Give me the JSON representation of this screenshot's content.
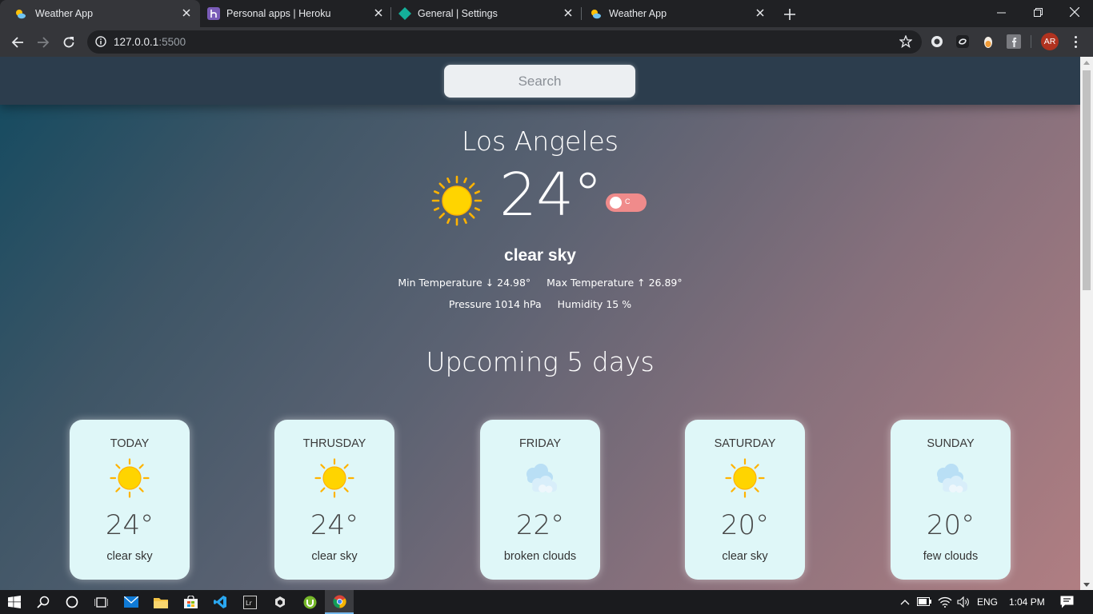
{
  "browser": {
    "tabs": [
      {
        "title": "Weather App",
        "icon": "weather-favicon",
        "active": true
      },
      {
        "title": "Personal apps | Heroku",
        "icon": "heroku-favicon",
        "active": false
      },
      {
        "title": "General | Settings",
        "icon": "settings-favicon",
        "active": false
      },
      {
        "title": "Weather App",
        "icon": "weather-favicon",
        "active": false
      }
    ],
    "url_host": "127.0.0.1",
    "url_port": ":5500",
    "profile_initials": "AR"
  },
  "page": {
    "search": {
      "placeholder": "Search",
      "value": ""
    },
    "city": "Los Angeles",
    "current": {
      "temperature": "24°",
      "unit_toggle": "C",
      "unit_is_celsius": true,
      "description": "clear sky",
      "icon": "sun-icon",
      "min_temp_label": "Min Temperature",
      "min_temp": "↓ 24.98°",
      "max_temp_label": "Max Temperature",
      "max_temp": "↑ 26.89°",
      "pressure_label": "Pressure",
      "pressure": "1014 hPa",
      "humidity_label": "Humidity",
      "humidity": "15 %"
    },
    "upcoming_title": "Upcoming 5 days",
    "forecast": [
      {
        "day": "TODAY",
        "temp": "24°",
        "desc": "clear sky",
        "icon": "sun"
      },
      {
        "day": "THRUSDAY",
        "temp": "24°",
        "desc": "clear sky",
        "icon": "sun"
      },
      {
        "day": "FRIDAY",
        "temp": "22°",
        "desc": "broken clouds",
        "icon": "clouds"
      },
      {
        "day": "SATURDAY",
        "temp": "20°",
        "desc": "clear sky",
        "icon": "sun"
      },
      {
        "day": "SUNDAY",
        "temp": "20°",
        "desc": "few clouds",
        "icon": "clouds"
      }
    ],
    "colors": {
      "card_bg": "#dff7f8",
      "toggle_bg": "#f08b8b",
      "sun_yellow": "#ffd400",
      "sun_orange": "#ffb300"
    }
  },
  "taskbar": {
    "language": "ENG",
    "time": "1:04 PM",
    "apps": [
      "start-icon",
      "search-icon",
      "cortana-icon",
      "task-view-icon",
      "mail-icon",
      "file-explorer-icon",
      "store-icon",
      "vscode-icon",
      "lightroom-icon",
      "unity-icon",
      "utorrent-icon",
      "chrome-icon"
    ]
  }
}
